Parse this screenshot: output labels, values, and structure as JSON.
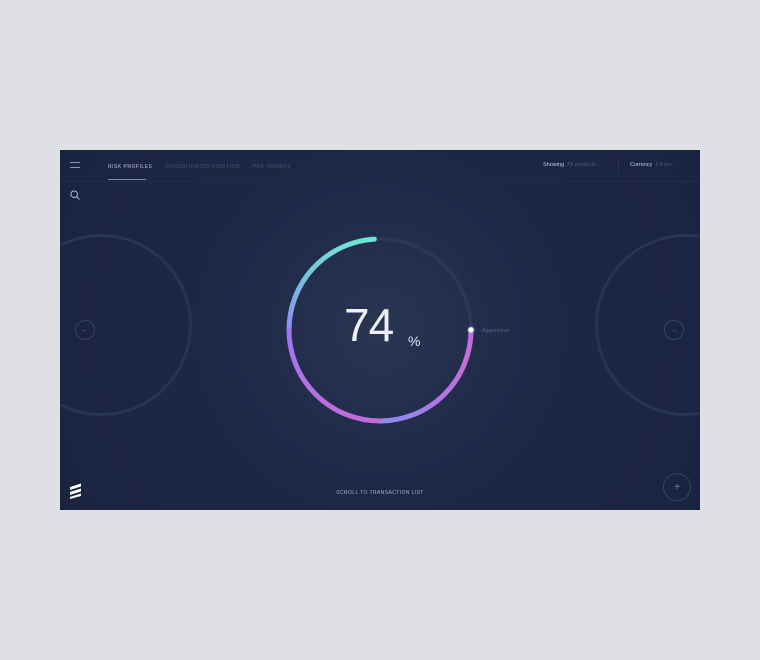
{
  "tabs": [
    {
      "label": "RISK PROFILES",
      "active": true
    },
    {
      "label": "CONSOLIDATED POSITION",
      "active": false
    },
    {
      "label": "PRE ORDERS",
      "active": false
    }
  ],
  "filters": {
    "showing_label": "Showing",
    "showing_value": "All products",
    "currency_label": "Currency",
    "currency_value": "€ Euro",
    "chevron": "⌄"
  },
  "icons": {
    "menu": "hamburger-icon",
    "search": "search-icon",
    "prev": "arrow-left-icon",
    "next": "arrow-right-icon",
    "add": "plus-icon",
    "logo": "brand-logo"
  },
  "nav": {
    "prev_glyph": "←",
    "next_glyph": "→",
    "add_glyph": "+"
  },
  "gauge": {
    "value": 74,
    "unit": "%",
    "marker_label": "Aggressive",
    "marker_fraction": 0.25
  },
  "footer": {
    "scroll_label": "SCROLL TO TRANSACTION LIST"
  },
  "colors": {
    "background": "#1c2544",
    "page": "#dfe0e5",
    "gauge_start": "#6ee6cf",
    "gauge_mid": "#8b88f6",
    "gauge_end": "#c66bd8",
    "track": "#2c3654"
  }
}
